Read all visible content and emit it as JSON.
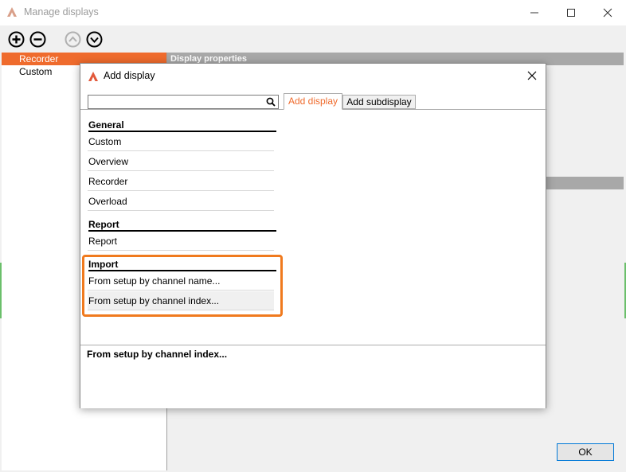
{
  "outer": {
    "title": "Manage displays",
    "list_items": [
      {
        "label": "Recorder",
        "selected": true
      },
      {
        "label": "Custom",
        "selected": false
      }
    ],
    "right_header": "Display properties",
    "ok_label": "OK"
  },
  "dialog": {
    "title": "Add display",
    "search": {
      "value": "",
      "placeholder": ""
    },
    "tabs": [
      {
        "label": "Add display",
        "active": true
      },
      {
        "label": "Add subdisplay",
        "active": false
      }
    ],
    "sections": [
      {
        "header": "General",
        "items": [
          "Custom",
          "Overview",
          "Recorder",
          "Overload"
        ]
      },
      {
        "header": "Report",
        "items": [
          "Report"
        ]
      },
      {
        "header": "Import",
        "items": [
          "From setup by channel name...",
          "From setup by channel index..."
        ]
      }
    ],
    "description": "From setup by channel index..."
  },
  "colors": {
    "accent": "#ef6b2d",
    "highlight_border": "#f07a1e",
    "header_gray": "#a8a8a8"
  },
  "icons": {
    "app": "app-logo-icon",
    "add": "plus-circle-icon",
    "remove": "minus-circle-icon",
    "move_up": "chevron-up-circle-icon",
    "move_down": "chevron-down-circle-icon",
    "search": "search-icon",
    "close": "close-icon"
  }
}
